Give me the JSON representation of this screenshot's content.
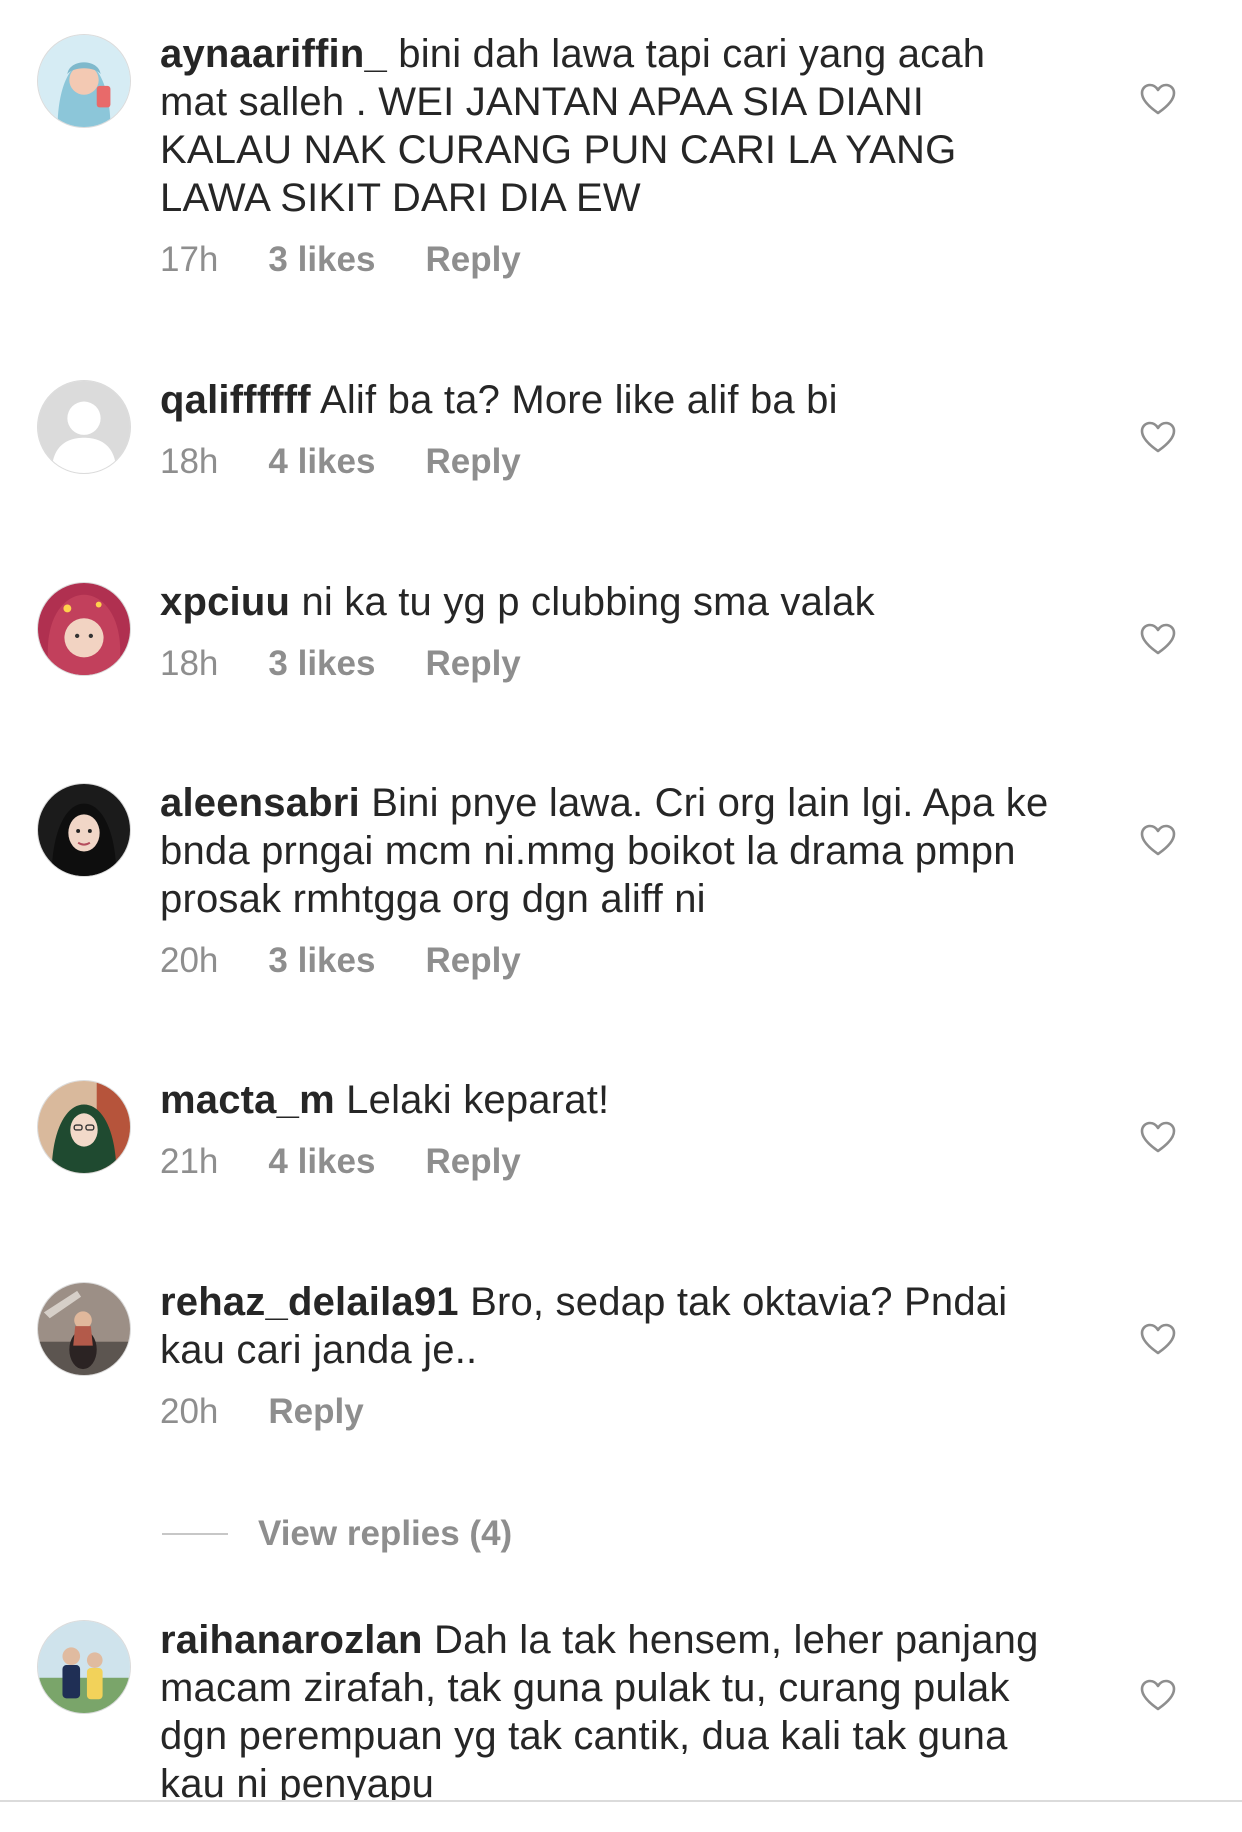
{
  "comments": [
    {
      "username": "aynaariffin_",
      "text": "bini dah lawa tapi cari yang acah mat salleh . WEI JANTAN APAA SIA DIANI KALAU NAK CURANG PUN CARI LA YANG LAWA SIKIT DARI DIA EW",
      "time": "17h",
      "likes": "3 likes",
      "reply": "Reply",
      "avatar_color": "#c9e3ef"
    },
    {
      "username": "qaliffffff",
      "text": "Alif ba ta? More like alif ba bi",
      "time": "18h",
      "likes": "4 likes",
      "reply": "Reply",
      "avatar_color": "#dbdbdb"
    },
    {
      "username": "xpciuu",
      "text": "ni ka tu yg p clubbing sma valak",
      "time": "18h",
      "likes": "3 likes",
      "reply": "Reply",
      "avatar_color": "#b3314a"
    },
    {
      "username": "aleensabri",
      "text": "Bini pnye lawa. Cri org lain lgi. Apa ke bnda prngai mcm ni.mmg boikot la drama pmpn prosak rmhtgga org dgn aliff ni",
      "time": "20h",
      "likes": "3 likes",
      "reply": "Reply",
      "avatar_color": "#1a1a1a"
    },
    {
      "username": "macta_m",
      "text": "Lelaki keparat!",
      "time": "21h",
      "likes": "4 likes",
      "reply": "Reply",
      "avatar_color": "#2f5a3c"
    },
    {
      "username": "rehaz_delaila91",
      "text": "Bro, sedap tak oktavia? Pndai kau cari janda je..",
      "time": "20h",
      "likes": "",
      "reply": "Reply",
      "avatar_color": "#6b5a52"
    },
    {
      "username": "raihanarozlan",
      "text": "Dah la tak hensem, leher panjang macam zirafah, tak guna pulak tu, curang pulak dgn perempuan yg tak cantik, dua kali tak guna kau ni penyapu",
      "time": "",
      "likes": "",
      "reply": "",
      "avatar_color": "#7aa56a"
    }
  ],
  "view_replies": "View replies (4)",
  "icons": {
    "like": "heart-outline-icon"
  },
  "colors": {
    "text": "#262626",
    "secondary": "#8e8e8e",
    "heart_stroke": "#8e8e8e"
  }
}
